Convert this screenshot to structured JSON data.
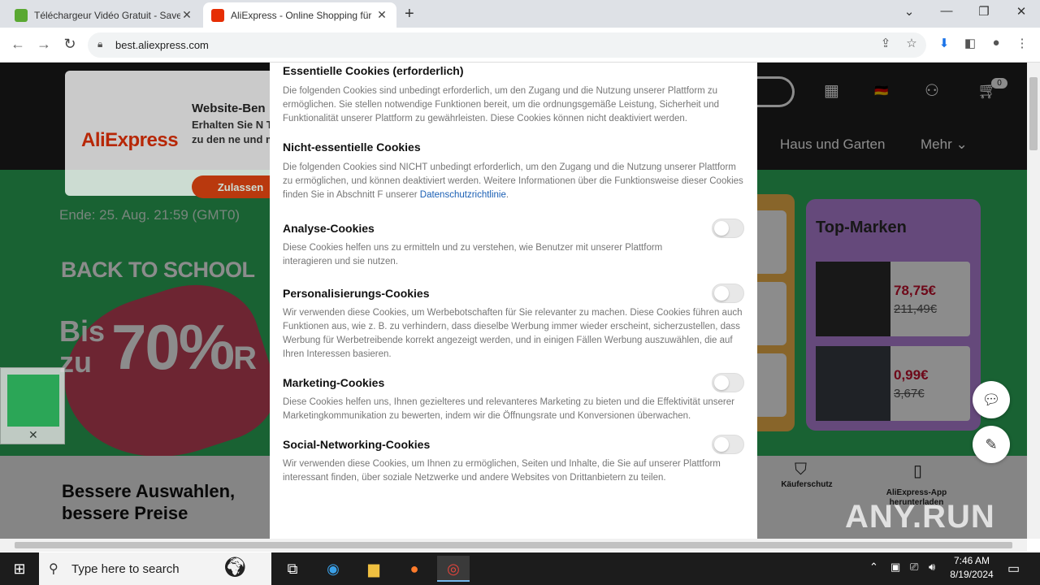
{
  "browser": {
    "tabs": [
      {
        "title": "Téléchargeur Vidéo Gratuit - Save",
        "active": false,
        "favicon_color": "#5aa832"
      },
      {
        "title": "AliExpress - Online Shopping für",
        "active": true,
        "favicon_color": "#e62e04"
      }
    ],
    "url": "best.aliexpress.com"
  },
  "page": {
    "promo": {
      "logo": "AliExpress",
      "title": "Website-Ben",
      "text": "Erhalten Sie N Tipps zu den ne und mehr!",
      "button": "Zulassen"
    },
    "banner": {
      "ende": "Ende: 25. Aug. 21:59 (GMT0)",
      "headline": "BACK TO SCHOOL",
      "bis": "Bis zu",
      "percent": "70%",
      "percent_suffix": "R"
    },
    "nav": {
      "haus": "Haus und Garten",
      "mehr": "Mehr",
      "cart_count": "0"
    },
    "topmarken": {
      "title": "Top-Marken",
      "products": [
        {
          "price": "78,75€",
          "old_price": "211,49€"
        },
        {
          "price": "0,99€",
          "old_price": "3,67€"
        }
      ]
    },
    "lower": {
      "headline": "Bessere Auswahlen, bessere Preise",
      "kaeuferschutz": "Käuferschutz",
      "app": "AliExpress-App herunterladen"
    },
    "watermark": "ANY.RUN"
  },
  "cookie_modal": {
    "sections": [
      {
        "title": "Essentielle Cookies (erforderlich)",
        "desc": "Die folgenden Cookies sind unbedingt erforderlich, um den Zugang und die Nutzung unserer Plattform zu ermöglichen. Sie stellen notwendige Funktionen bereit, um die ordnungsgemäße Leistung, Sicherheit und Funktionalität unserer Plattform zu gewährleisten. Diese Cookies können nicht deaktiviert werden."
      },
      {
        "title": "Nicht-essentielle Cookies",
        "desc": "Die folgenden Cookies sind NICHT unbedingt erforderlich, um den Zugang und die Nutzung unserer Plattform zu ermöglichen, und können deaktiviert werden. Weitere Informationen über die Funktionsweise dieser Cookies finden Sie in Abschnitt F unserer ",
        "link": "Datenschutzrichtlinie",
        "desc_after": "."
      },
      {
        "title": "Analyse-Cookies",
        "desc": "Diese Cookies helfen uns zu ermitteln und zu verstehen, wie Benutzer mit unserer Plattform interagieren und sie nutzen.",
        "enabled": false
      },
      {
        "title": "Personalisierungs-Cookies",
        "desc": "Wir verwenden diese Cookies, um Werbebotschaften für Sie relevanter zu machen. Diese Cookies führen auch Funktionen aus, wie z. B. zu verhindern, dass dieselbe Werbung immer wieder erscheint, sicherzustellen, dass Werbung für Werbetreibende korrekt angezeigt werden, und in einigen Fällen Werbung auszuwählen, die auf Ihren Interessen basieren.",
        "enabled": false
      },
      {
        "title": "Marketing-Cookies",
        "desc": "Diese Cookies helfen uns, Ihnen gezielteres und relevanteres Marketing zu bieten und die Effektivität unserer Marketingkommunikation zu bewerten, indem wir die Öffnungsrate und Konversionen überwachen.",
        "enabled": false
      },
      {
        "title": "Social-Networking-Cookies",
        "desc": "Wir verwenden diese Cookies, um Ihnen zu ermöglichen, Seiten und Inhalte, die Sie auf unserer Plattform interessant finden, über soziale Netzwerke und andere Websites von Drittanbietern zu teilen.",
        "enabled": false
      }
    ]
  },
  "taskbar": {
    "search_placeholder": "Type here to search",
    "time": "7:46 AM",
    "date": "8/19/2024"
  }
}
